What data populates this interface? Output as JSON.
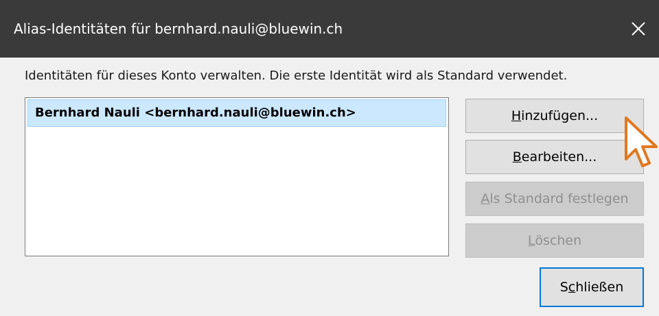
{
  "window": {
    "title": "Alias-Identitäten für bernhard.nauli@bluewin.ch",
    "close_icon": "close-icon"
  },
  "description": "Identitäten für dieses Konto verwalten. Die erste Identität wird als Standard verwendet.",
  "identities": [
    {
      "label": "Bernhard Nauli <bernhard.nauli@bluewin.ch>",
      "selected": true
    }
  ],
  "buttons": {
    "add": {
      "before": "",
      "accel": "H",
      "after": "inzufügen...",
      "enabled": true
    },
    "edit": {
      "before": "",
      "accel": "B",
      "after": "earbeiten...",
      "enabled": true
    },
    "set_default": {
      "before": "",
      "accel": "A",
      "after": "ls Standard festlegen",
      "enabled": false
    },
    "delete": {
      "before": "",
      "accel": "L",
      "after": "öschen",
      "enabled": false
    },
    "close": {
      "before": "S",
      "accel": "c",
      "after": "hließen",
      "enabled": true
    }
  },
  "colors": {
    "titlebar": "#3a3a3a",
    "selection": "#cce8ff",
    "focus_border": "#0078d7",
    "cursor_outline": "#e07820"
  }
}
